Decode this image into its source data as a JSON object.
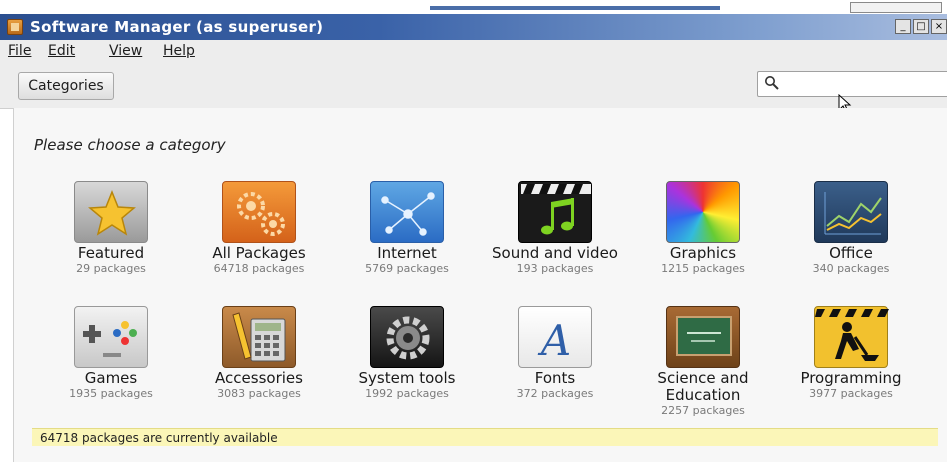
{
  "window": {
    "title": "Software Manager (as superuser)",
    "minimize_icon": "_",
    "maximize_icon": "□",
    "close_icon": "×"
  },
  "menu": {
    "file": "File",
    "edit": "Edit",
    "view": "View",
    "help": "Help"
  },
  "toolbar": {
    "categories_label": "Categories",
    "search_placeholder": ""
  },
  "content": {
    "heading": "Please choose a category",
    "categories": [
      {
        "name": "Featured",
        "count": "29 packages",
        "icon": "star-icon"
      },
      {
        "name": "All Packages",
        "count": "64718 packages",
        "icon": "gears-icon"
      },
      {
        "name": "Internet",
        "count": "5769 packages",
        "icon": "network-globe-icon"
      },
      {
        "name": "Sound and video",
        "count": "193 packages",
        "icon": "clapperboard-music-icon"
      },
      {
        "name": "Graphics",
        "count": "1215 packages",
        "icon": "color-wheel-icon"
      },
      {
        "name": "Office",
        "count": "340 packages",
        "icon": "line-chart-icon"
      },
      {
        "name": "Games",
        "count": "1935 packages",
        "icon": "gamepad-icon"
      },
      {
        "name": "Accessories",
        "count": "3083 packages",
        "icon": "calculator-pencil-icon"
      },
      {
        "name": "System tools",
        "count": "1992 packages",
        "icon": "gear-icon"
      },
      {
        "name": "Fonts",
        "count": "372 packages",
        "icon": "letter-a-icon"
      },
      {
        "name": "Science and Education",
        "count": "2257 packages",
        "icon": "chalkboard-icon"
      },
      {
        "name": "Programming",
        "count": "3977 packages",
        "icon": "construction-worker-icon"
      }
    ]
  },
  "status": {
    "text": "64718 packages are currently available"
  },
  "colors": {
    "titlebar": "#2b4f8f",
    "status_bg": "#fbf6b8",
    "background": "#f7f7f7"
  }
}
